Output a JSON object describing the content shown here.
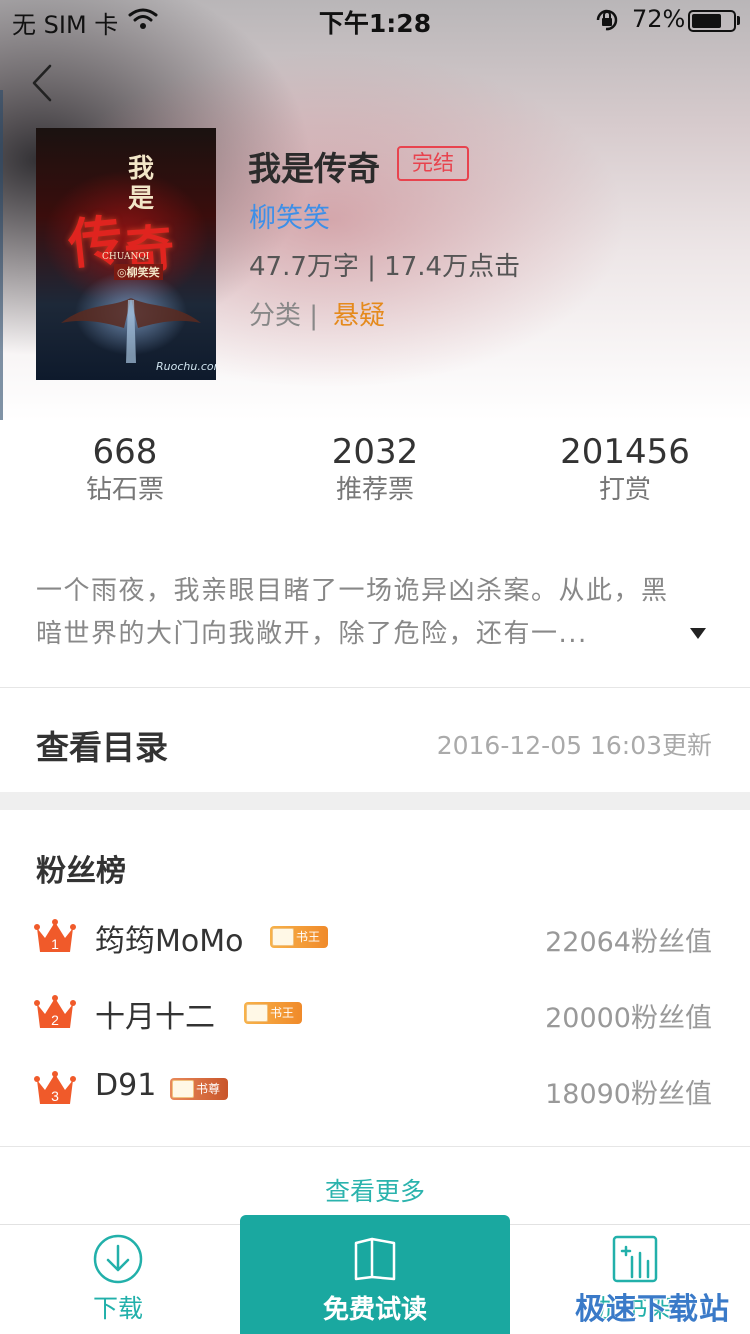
{
  "status_bar": {
    "carrier": "无 SIM 卡",
    "time": "下午1:28",
    "battery_percent": "72%",
    "battery_level": 0.72
  },
  "book": {
    "title": "我是传奇",
    "status": "完结",
    "author": "柳笑笑",
    "stats": "47.7万字 | 17.4万点击",
    "category_label": "分类 |",
    "category": "悬疑",
    "cover": {
      "title_chars": [
        "我",
        "是",
        "传",
        "奇"
      ],
      "pinyin": "CHUANQI",
      "author": "◎柳笑笑",
      "brand": "Ruochu.com"
    }
  },
  "metrics": [
    {
      "value": "668",
      "label": "钻石票"
    },
    {
      "value": "2032",
      "label": "推荐票"
    },
    {
      "value": "201456",
      "label": "打赏"
    }
  ],
  "intro": {
    "line1": "一个雨夜，我亲眼目睹了一场诡异凶杀案。从此，黑",
    "line2": "暗世界的大门向我敞开，除了危险，还有一..."
  },
  "toc": {
    "label": "查看目录",
    "updated": "2016-12-05 16:03更新"
  },
  "fans": {
    "title": "粉丝榜",
    "items": [
      {
        "rank": "1",
        "name": "筠筠MoMo",
        "badge": "书王",
        "score": "22064粉丝值"
      },
      {
        "rank": "2",
        "name": "十月十二",
        "badge": "书王",
        "score": "20000粉丝值"
      },
      {
        "rank": "3",
        "name": "D91",
        "badge": "书尊",
        "score": "18090粉丝值"
      }
    ],
    "more": "查看更多"
  },
  "bottom_bar": {
    "download": "下载",
    "read": "免费试读",
    "shelf": "加书架"
  },
  "watermark": "极速下载站",
  "colors": {
    "accent": "#1aa8a0",
    "author": "#3d8fe8",
    "category": "#e58a1c",
    "status_badge": "#e8434e",
    "crown": "#f05a2a"
  }
}
